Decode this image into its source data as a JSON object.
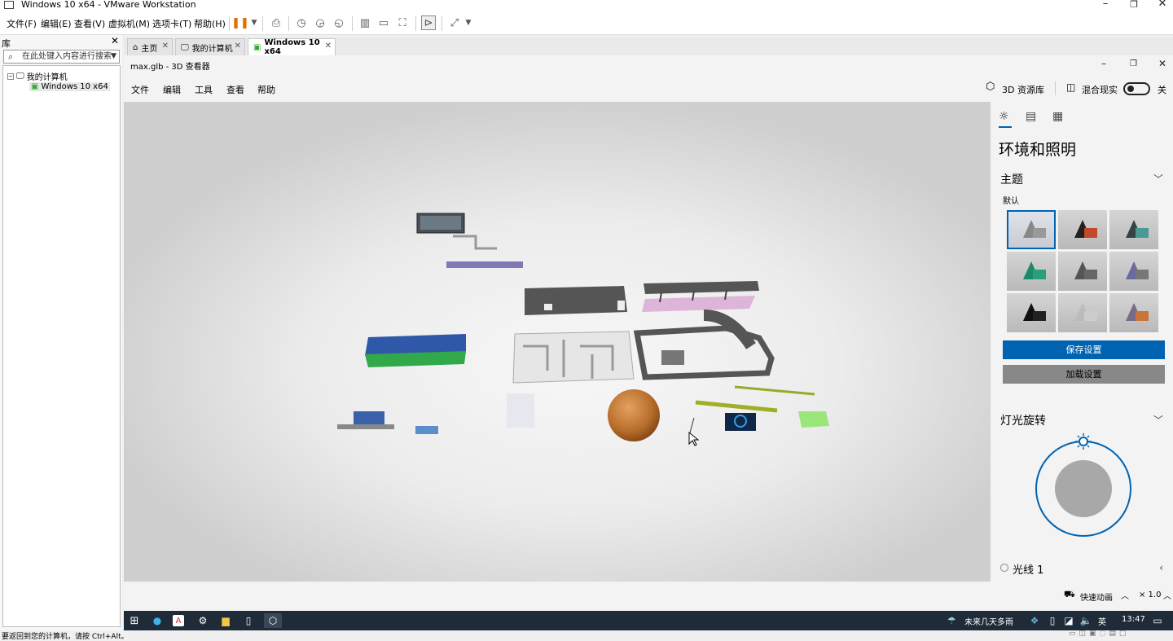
{
  "vmware": {
    "title": "Windows 10 x64 - VMware Workstation",
    "menu": [
      "文件(F)",
      "编辑(E)",
      "查看(V)",
      "虚拟机(M)",
      "选项卡(T)",
      "帮助(H)"
    ]
  },
  "library": {
    "header": "库",
    "search_placeholder": "在此处键入内容进行搜索",
    "tree": [
      {
        "label": "我的计算机"
      },
      {
        "label": "Windows 10 x64"
      }
    ],
    "status": "要返回到您的计算机，请按 Ctrl+Alt。"
  },
  "tabs": [
    {
      "label": "主页",
      "icon": "home-icon"
    },
    {
      "label": "我的计算机",
      "icon": "computer-icon"
    },
    {
      "label": "Windows 10 x64",
      "icon": "vm-icon",
      "active": true
    }
  ],
  "app": {
    "title": "max.glb - 3D 查看器",
    "menu": [
      "文件",
      "编辑",
      "工具",
      "查看",
      "帮助"
    ],
    "library_button": "3D 资源库",
    "mixed_reality_label": "混合现实",
    "mixed_reality_state": "关",
    "mixed_reality_on": false,
    "panel": {
      "title": "环境和照明",
      "theme_section": "主题",
      "theme_default_label": "默认",
      "theme_count": 9,
      "selected_theme_index": 0,
      "save_button": "保存设置",
      "load_button": "加载设置",
      "light_rotation_section": "灯光旋转",
      "light1_label": "光线 1"
    },
    "bottom": {
      "quick_animation": "快速动画",
      "zoom": "× 1.0"
    }
  },
  "taskbar": {
    "weather": "未来几天多雨",
    "ime": "英",
    "time": "13:47"
  },
  "colors": {
    "accent": "#0063b1",
    "taskbar": "#1f2b38"
  }
}
